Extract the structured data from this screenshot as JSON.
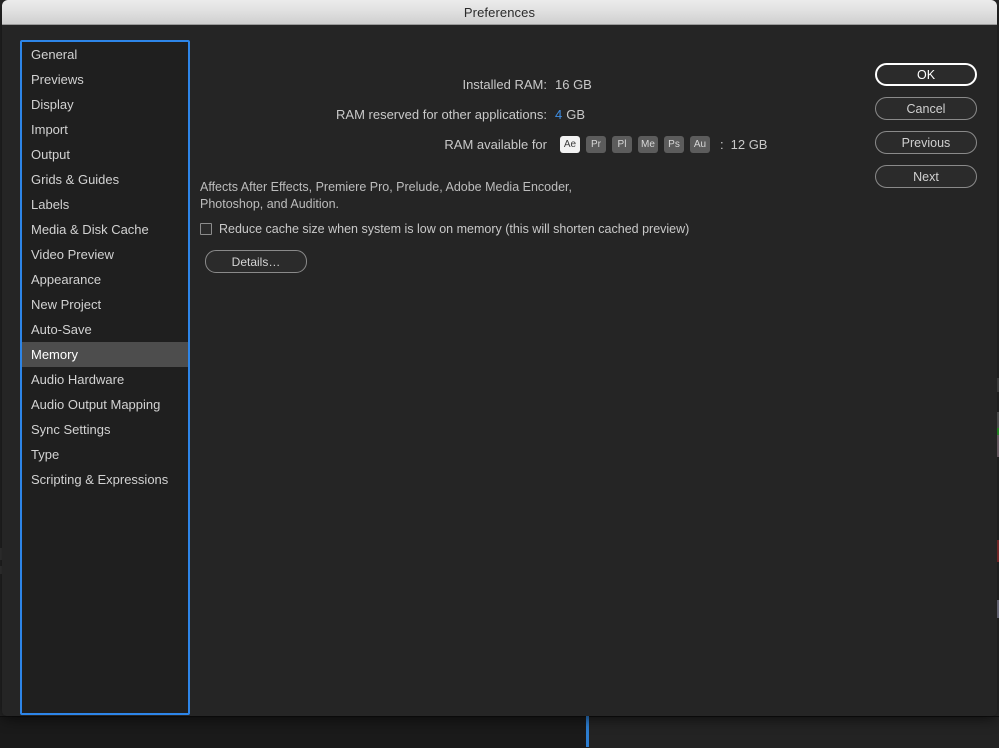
{
  "dialog": {
    "title": "Preferences"
  },
  "sidebar": {
    "items": [
      {
        "label": "General",
        "selected": false
      },
      {
        "label": "Previews",
        "selected": false
      },
      {
        "label": "Display",
        "selected": false
      },
      {
        "label": "Import",
        "selected": false
      },
      {
        "label": "Output",
        "selected": false
      },
      {
        "label": "Grids & Guides",
        "selected": false
      },
      {
        "label": "Labels",
        "selected": false
      },
      {
        "label": "Media & Disk Cache",
        "selected": false
      },
      {
        "label": "Video Preview",
        "selected": false
      },
      {
        "label": "Appearance",
        "selected": false
      },
      {
        "label": "New Project",
        "selected": false
      },
      {
        "label": "Auto-Save",
        "selected": false
      },
      {
        "label": "Memory",
        "selected": true
      },
      {
        "label": "Audio Hardware",
        "selected": false
      },
      {
        "label": "Audio Output Mapping",
        "selected": false
      },
      {
        "label": "Sync Settings",
        "selected": false
      },
      {
        "label": "Type",
        "selected": false
      },
      {
        "label": "Scripting & Expressions",
        "selected": false
      }
    ]
  },
  "memory": {
    "installed_ram_label": "Installed RAM:",
    "installed_ram_value": "16 GB",
    "reserved_ram_label": "RAM reserved for other applications:",
    "reserved_ram_value_number": "4",
    "reserved_ram_value_unit": "GB",
    "available_ram_label": "RAM available for",
    "available_ram_separator": ":",
    "available_ram_value": "12 GB",
    "app_icons": [
      {
        "label": "Ae",
        "name": "after-effects-icon",
        "active": true
      },
      {
        "label": "Pr",
        "name": "premiere-pro-icon",
        "active": false
      },
      {
        "label": "Pl",
        "name": "prelude-icon",
        "active": false
      },
      {
        "label": "Me",
        "name": "media-encoder-icon",
        "active": false
      },
      {
        "label": "Ps",
        "name": "photoshop-icon",
        "active": false
      },
      {
        "label": "Au",
        "name": "audition-icon",
        "active": false
      }
    ],
    "affects_text": "Affects After Effects, Premiere Pro, Prelude, Adobe Media Encoder, Photoshop, and Audition.",
    "reduce_cache_label": "Reduce cache size when system is low on memory (this will shorten cached preview)",
    "reduce_cache_checked": false,
    "details_button_label": "Details…"
  },
  "actions": {
    "ok_label": "OK",
    "cancel_label": "Cancel",
    "previous_label": "Previous",
    "next_label": "Next"
  },
  "colors": {
    "accent_blue": "#2d85e8",
    "hot_text_blue": "#3e8ee4",
    "dialog_background": "#252525",
    "sidebar_background": "#1f1f1f",
    "selected_row": "#4d4d4d",
    "titlebar_text": "#2a2a2a"
  }
}
